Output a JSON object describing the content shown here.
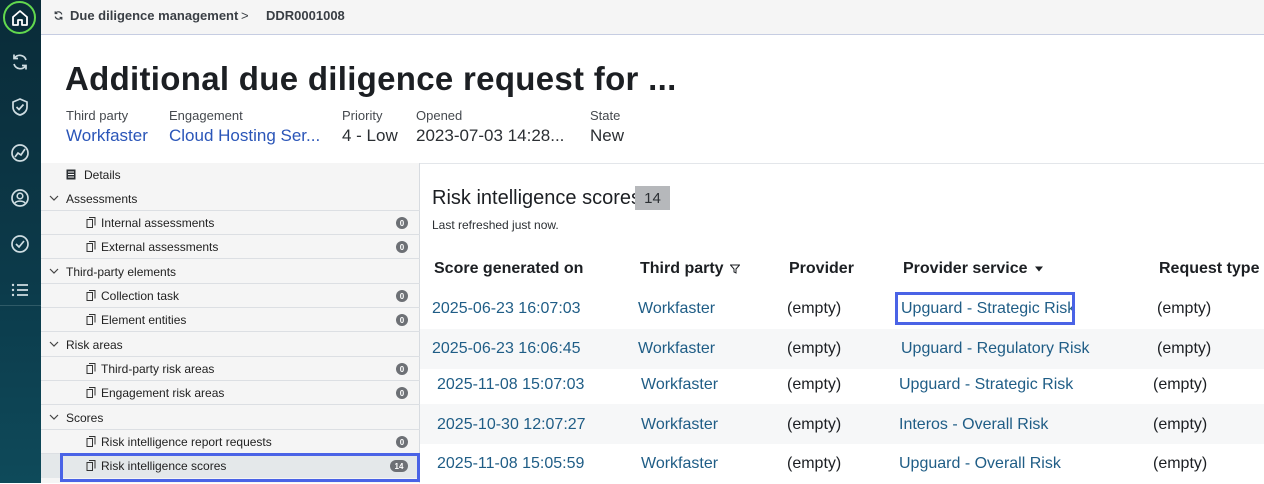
{
  "breadcrumb": {
    "parent": "Due diligence management",
    "separator": ">",
    "current": "DDR0001008"
  },
  "page_title": "Additional due diligence request for ...",
  "meta": [
    {
      "label": "Third party",
      "value": "Workfaster",
      "link": true
    },
    {
      "label": "Engagement",
      "value": "Cloud Hosting Ser...",
      "link": true
    },
    {
      "label": "Priority",
      "value": "4 - Low",
      "link": false
    },
    {
      "label": "Opened",
      "value": "2023-07-03 14:28...",
      "link": false
    },
    {
      "label": "State",
      "value": "New",
      "link": false
    }
  ],
  "sidebar": {
    "details": "Details",
    "groups": [
      {
        "label": "Assessments",
        "items": [
          {
            "label": "Internal assessments",
            "count": "0"
          },
          {
            "label": "External assessments",
            "count": "0"
          }
        ]
      },
      {
        "label": "Third-party elements",
        "items": [
          {
            "label": "Collection task",
            "count": "0"
          },
          {
            "label": "Element entities",
            "count": "0"
          }
        ]
      },
      {
        "label": "Risk areas",
        "items": [
          {
            "label": "Third-party risk areas",
            "count": "0"
          },
          {
            "label": "Engagement risk areas",
            "count": "0"
          }
        ]
      },
      {
        "label": "Scores",
        "items": [
          {
            "label": "Risk intelligence report requests",
            "count": "0"
          },
          {
            "label": "Risk intelligence scores",
            "count": "14"
          }
        ]
      }
    ]
  },
  "list": {
    "title": "Risk intelligence scores",
    "count": "14",
    "refreshed": "Last refreshed just now.",
    "columns": [
      "Score generated on",
      "Third party",
      "Provider",
      "Provider service",
      "Request type"
    ],
    "rows": [
      [
        "2025-06-23 16:07:03",
        "Workfaster",
        "(empty)",
        "Upguard - Strategic Risk",
        "(empty)"
      ],
      [
        "2025-06-23 16:06:45",
        "Workfaster",
        "(empty)",
        "Upguard - Regulatory Risk",
        "(empty)"
      ],
      [
        "2025-11-08 15:07:03",
        "Workfaster",
        "(empty)",
        "Upguard - Strategic Risk",
        "(empty)"
      ],
      [
        "2025-10-30 12:07:27",
        "Workfaster",
        "(empty)",
        "Interos - Overall Risk",
        "(empty)"
      ],
      [
        "2025-11-08 15:05:59",
        "Workfaster",
        "(empty)",
        "Upguard - Overall Risk",
        "(empty)"
      ]
    ]
  },
  "colors": {
    "rail": "#0c3b4b",
    "home_ring": "#62d84e",
    "link": "#2a55b8",
    "table_link": "#1f5d86",
    "highlight": "#4a63e6"
  }
}
